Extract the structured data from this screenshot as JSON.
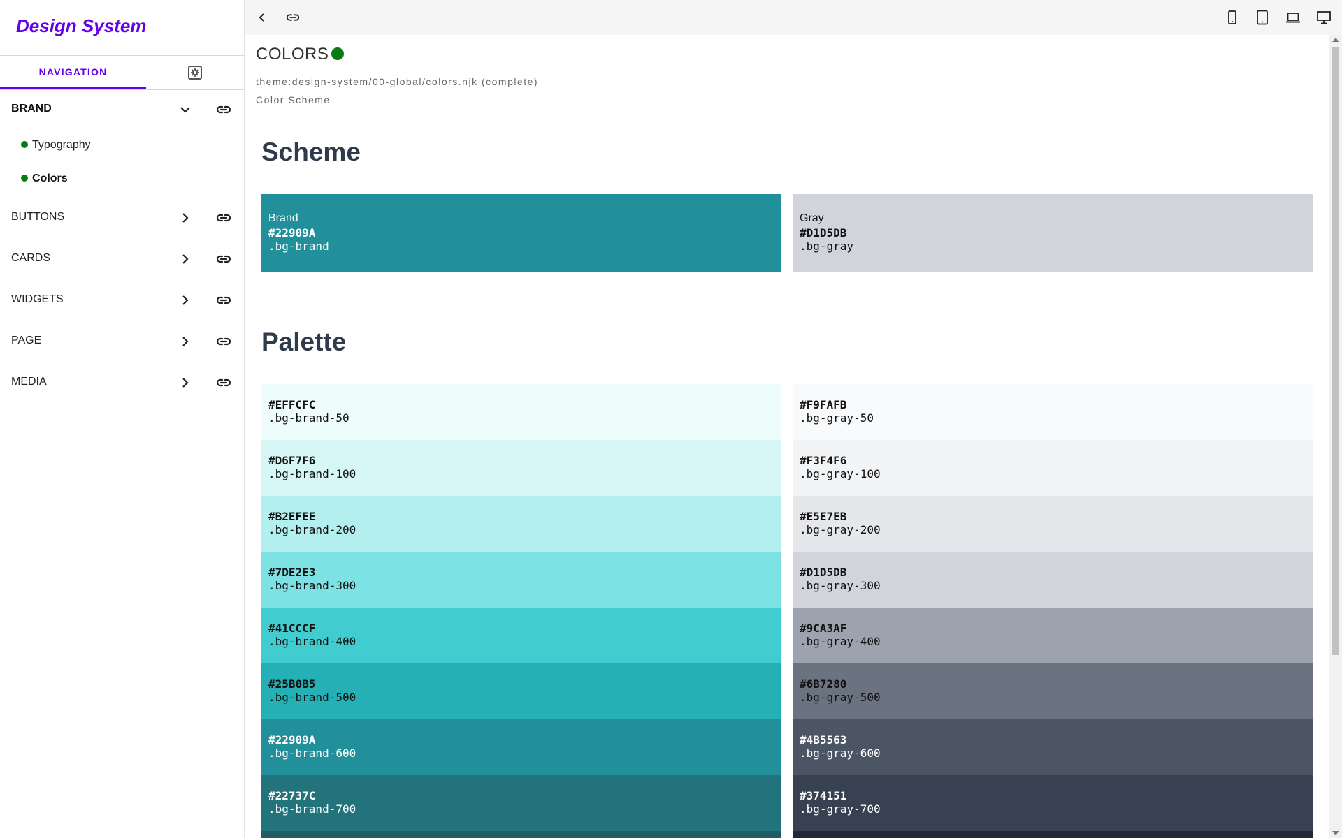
{
  "sidebar": {
    "logo": "Design System",
    "tab_navigation": "NAVIGATION",
    "items": [
      {
        "label": "BRAND",
        "expanded": true
      },
      {
        "label": "BUTTONS",
        "expanded": false
      },
      {
        "label": "CARDS",
        "expanded": false
      },
      {
        "label": "WIDGETS",
        "expanded": false
      },
      {
        "label": "PAGE",
        "expanded": false
      },
      {
        "label": "MEDIA",
        "expanded": false
      }
    ],
    "brand_children": [
      "Typography",
      "Colors"
    ]
  },
  "topbar": {
    "icons": [
      "back-icon",
      "link-icon",
      "mobile-icon",
      "tablet-icon",
      "laptop-icon",
      "desktop-icon"
    ]
  },
  "page": {
    "title": "COLORS",
    "path": "theme:design-system/00-global/colors.njk (complete)",
    "subtitle": "Color Scheme",
    "scheme_heading": "Scheme",
    "palette_heading": "Palette"
  },
  "scheme": [
    {
      "name": "Brand",
      "hex": "#22909A",
      "cls": ".bg-brand",
      "bg": "#22909A",
      "fg": "#ffffff"
    },
    {
      "name": "Gray",
      "hex": "#D1D5DB",
      "cls": ".bg-gray",
      "bg": "#D1D5DB",
      "fg": "#111111"
    }
  ],
  "palette": {
    "brand": [
      {
        "hex": "#EFFCFC",
        "cls": ".bg-brand-50",
        "fg": "#111111"
      },
      {
        "hex": "#D6F7F6",
        "cls": ".bg-brand-100",
        "fg": "#111111"
      },
      {
        "hex": "#B2EFEE",
        "cls": ".bg-brand-200",
        "fg": "#111111"
      },
      {
        "hex": "#7DE2E3",
        "cls": ".bg-brand-300",
        "fg": "#111111"
      },
      {
        "hex": "#41CCCF",
        "cls": ".bg-brand-400",
        "fg": "#111111"
      },
      {
        "hex": "#25B0B5",
        "cls": ".bg-brand-500",
        "fg": "#111111"
      },
      {
        "hex": "#22909A",
        "cls": ".bg-brand-600",
        "fg": "#ffffff"
      },
      {
        "hex": "#22737C",
        "cls": ".bg-brand-700",
        "fg": "#ffffff"
      }
    ],
    "gray": [
      {
        "hex": "#F9FAFB",
        "cls": ".bg-gray-50",
        "fg": "#111111"
      },
      {
        "hex": "#F3F4F6",
        "cls": ".bg-gray-100",
        "fg": "#111111"
      },
      {
        "hex": "#E5E7EB",
        "cls": ".bg-gray-200",
        "fg": "#111111"
      },
      {
        "hex": "#D1D5DB",
        "cls": ".bg-gray-300",
        "fg": "#111111"
      },
      {
        "hex": "#9CA3AF",
        "cls": ".bg-gray-400",
        "fg": "#111111"
      },
      {
        "hex": "#6B7280",
        "cls": ".bg-gray-500",
        "fg": "#111111"
      },
      {
        "hex": "#4B5563",
        "cls": ".bg-gray-600",
        "fg": "#ffffff"
      },
      {
        "hex": "#374151",
        "cls": ".bg-gray-700",
        "fg": "#ffffff"
      }
    ]
  },
  "colors": {
    "accent": "#6200EA",
    "status_green": "#0B7A14",
    "heading": "#2F3A4A",
    "brand_800": "#1F5C65",
    "gray_800": "#1F2937"
  }
}
